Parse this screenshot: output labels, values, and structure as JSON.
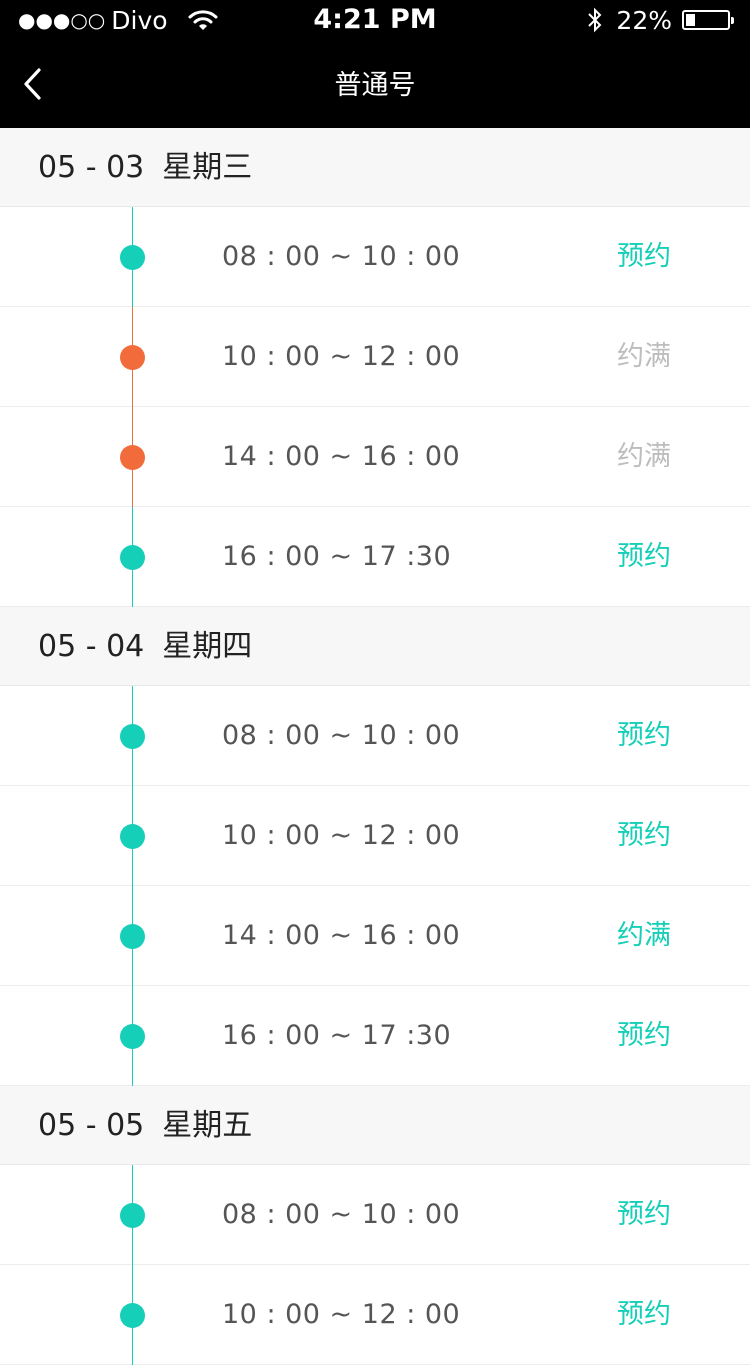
{
  "status_bar": {
    "signal": "●●●○○",
    "carrier": "Divo",
    "time": "4:21 PM",
    "battery_percent": "22%",
    "battery_level": 0.22
  },
  "nav": {
    "title": "普通号"
  },
  "colors": {
    "available": "#15cfb8",
    "full": "#f26b3a",
    "full_text": "#bdbdbd"
  },
  "days": [
    {
      "date": "05 - 03",
      "weekday": "星期三",
      "slots": [
        {
          "time": "08 : 00 ~ 10 : 00",
          "action": "预约",
          "dot": "available",
          "line": "available",
          "text": "available"
        },
        {
          "time": "10 : 00 ~ 12 : 00",
          "action": "约满",
          "dot": "full",
          "line": "full",
          "text": "full_text"
        },
        {
          "time": "14 : 00 ~ 16 : 00",
          "action": "约满",
          "dot": "full",
          "line": "full",
          "text": "full_text"
        },
        {
          "time": "16 : 00 ~ 17 :30",
          "action": "预约",
          "dot": "available",
          "line": "available",
          "text": "available"
        }
      ]
    },
    {
      "date": "05 - 04",
      "weekday": "星期四",
      "slots": [
        {
          "time": "08 : 00 ~ 10 : 00",
          "action": "预约",
          "dot": "available",
          "line": "available",
          "text": "available"
        },
        {
          "time": "10 : 00 ~ 12 : 00",
          "action": "预约",
          "dot": "available",
          "line": "available",
          "text": "available"
        },
        {
          "time": "14 : 00 ~ 16 : 00",
          "action": "约满",
          "dot": "available",
          "line": "available",
          "text": "available"
        },
        {
          "time": "16 : 00 ~ 17 :30",
          "action": "预约",
          "dot": "available",
          "line": "available",
          "text": "available"
        }
      ]
    },
    {
      "date": "05 - 05",
      "weekday": "星期五",
      "slots": [
        {
          "time": "08 : 00 ~ 10 : 00",
          "action": "预约",
          "dot": "available",
          "line": "available",
          "text": "available"
        },
        {
          "time": "10 : 00 ~ 12 : 00",
          "action": "预约",
          "dot": "available",
          "line": "available",
          "text": "available"
        }
      ]
    }
  ],
  "icons": {
    "back": "chevron-left-icon",
    "wifi": "wifi-icon",
    "bluetooth": "bluetooth-icon",
    "battery": "battery-icon"
  }
}
